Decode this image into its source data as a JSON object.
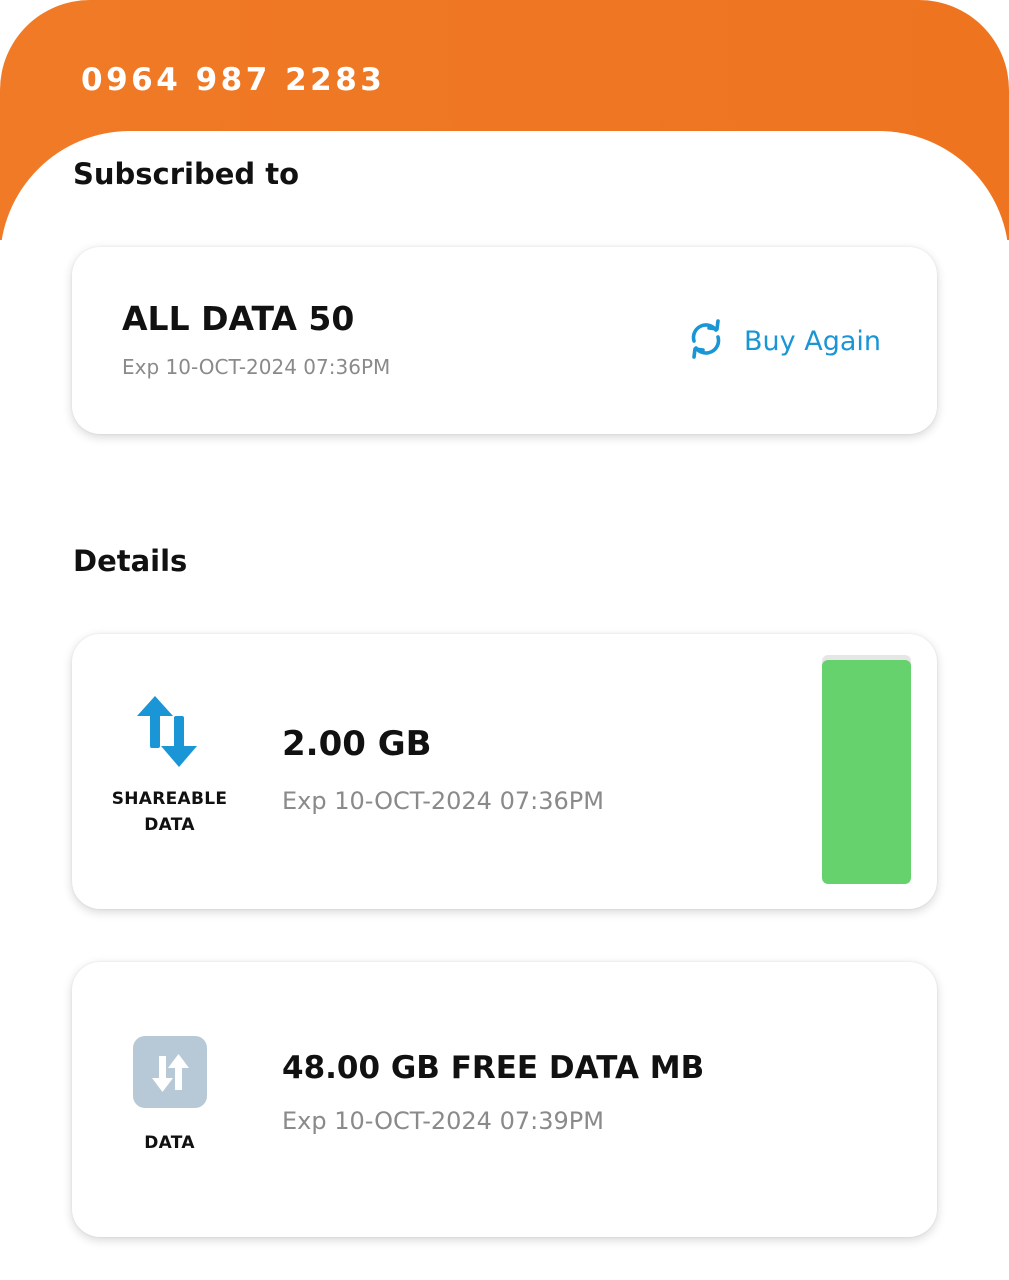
{
  "account": {
    "phone_number": "0964 987 2283"
  },
  "subscribed": {
    "section_title": "Subscribed to",
    "plan_name": "ALL DATA 50",
    "expiry": "Exp 10-OCT-2024 07:36PM",
    "buy_again_label": "Buy Again",
    "buy_again_icon": "refresh-icon"
  },
  "details": {
    "section_title": "Details",
    "items": [
      {
        "caption_line1": "SHAREABLE",
        "caption_line2": "DATA",
        "icon": "data-transfer-icon",
        "amount": "2.00 GB",
        "expiry": "Exp 10-OCT-2024 07:36PM",
        "remaining_fraction": 0.98
      },
      {
        "caption_line1": "DATA",
        "icon": "data-transfer-icon",
        "amount": "48.00 GB FREE DATA MB",
        "expiry": "Exp 10-OCT-2024 07:39PM"
      }
    ]
  },
  "colors": {
    "header": "#f07a26",
    "accent_blue": "#1a95d6",
    "usage_green": "#66d26e",
    "icon_grey": "#b7c9d6"
  }
}
